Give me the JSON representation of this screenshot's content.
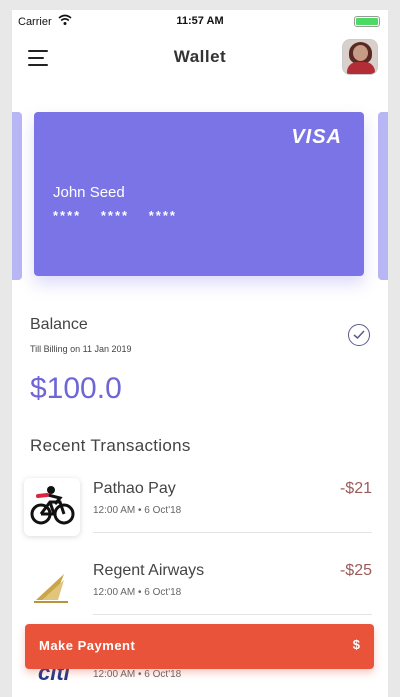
{
  "status_bar": {
    "carrier": "Carrier",
    "time": "11:57 AM"
  },
  "nav": {
    "title": "Wallet",
    "menu_icon": "hamburger-menu-icon",
    "avatar_icon": "user-avatar"
  },
  "card": {
    "brand": "VISA",
    "holder": "John Seed",
    "number": "**** **** ****",
    "color": "#7b74e6"
  },
  "balance": {
    "label": "Balance",
    "subtitle": "Till Billing on 11 Jan 2019",
    "amount": "$100.0",
    "status_icon": "check-circle-icon"
  },
  "transactions": {
    "title": "Recent Transactions",
    "items": [
      {
        "name": "Pathao Pay",
        "meta": "12:00 AM • 6 Oct'18",
        "amount": "-$21",
        "logo": "bicycle-logo"
      },
      {
        "name": "Regent Airways",
        "meta": "12:00 AM • 6 Oct'18",
        "amount": "-$25",
        "logo": "airline-wing-logo"
      },
      {
        "name": "",
        "meta": "12:00 AM • 6 Oct'18",
        "amount": "",
        "logo": "citi-logo"
      }
    ],
    "partial_logo_text": "citi"
  },
  "pay_button": {
    "label": "Make Payment",
    "currency": "$",
    "color": "#e8533a"
  },
  "colors": {
    "accent": "#7b74e6",
    "amount_negative": "#9b5b5b",
    "balance": "#6e66d6"
  }
}
